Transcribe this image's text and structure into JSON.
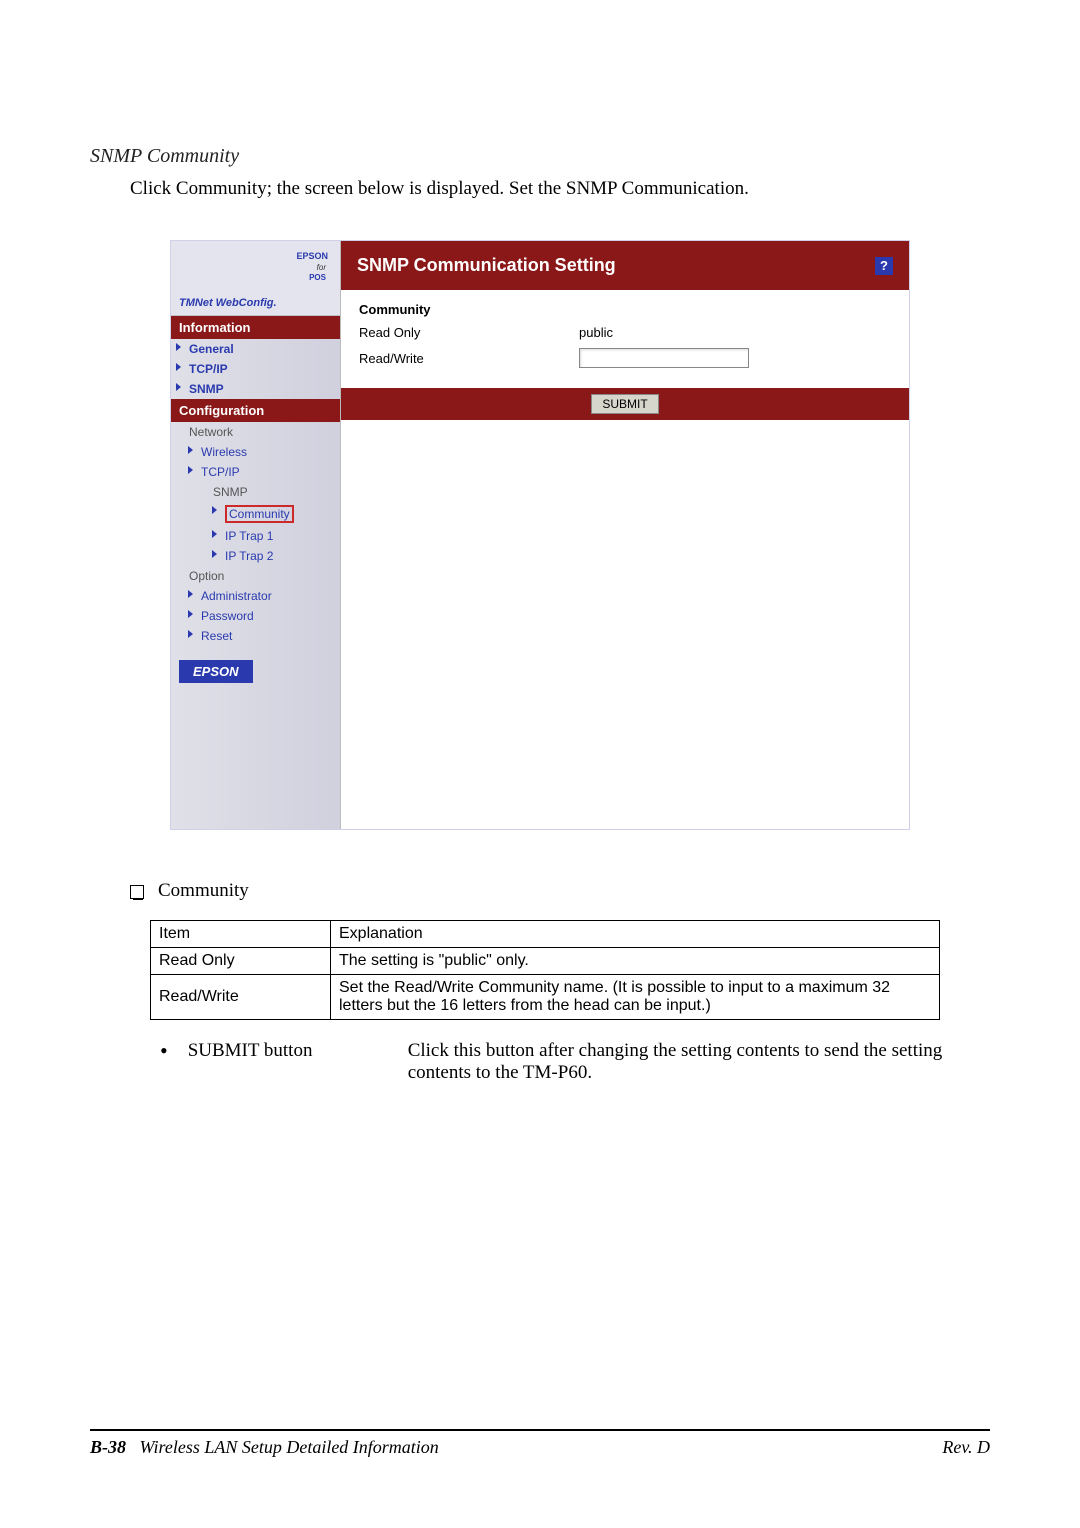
{
  "section_title": "SNMP Community",
  "intro": "Click Community; the screen below is displayed. Set the SNMP Communication.",
  "screenshot": {
    "logo": {
      "brand": "EPSON",
      "for": "for",
      "pos": "POS",
      "tmnet": "TMNet WebConfig."
    },
    "nav": {
      "info_header": "Information",
      "general": "General",
      "tcpip": "TCP/IP",
      "snmp": "SNMP",
      "config_header": "Configuration",
      "network": "Network",
      "wireless": "Wireless",
      "tcpip2": "TCP/IP",
      "snmp2": "SNMP",
      "community": "Community",
      "iptrap1": "IP Trap 1",
      "iptrap2": "IP Trap 2",
      "option": "Option",
      "administrator": "Administrator",
      "password": "Password",
      "reset": "Reset"
    },
    "epson_badge": "EPSON",
    "pane_title": "SNMP Communication Setting",
    "help": "?",
    "form_title": "Community",
    "read_only_label": "Read Only",
    "read_only_value": "public",
    "read_write_label": "Read/Write",
    "read_write_value": "",
    "submit_label": "SUBMIT"
  },
  "expl": {
    "checkbox_label": "Community",
    "headers": {
      "item": "Item",
      "explanation": "Explanation"
    },
    "rows": [
      {
        "item": "Read Only",
        "explanation": "The setting is \"public\" only."
      },
      {
        "item": "Read/Write",
        "explanation": "Set the Read/Write Community name. (It is possible to input to a maximum 32 letters but the 16 letters from the head can be input.)"
      }
    ]
  },
  "bullet": {
    "label": "SUBMIT button",
    "text": "Click this button after changing the setting contents to send the setting contents to the TM-P60."
  },
  "footer": {
    "page": "B-38",
    "title": "Wireless LAN Setup Detailed Information",
    "rev": "Rev. D"
  }
}
